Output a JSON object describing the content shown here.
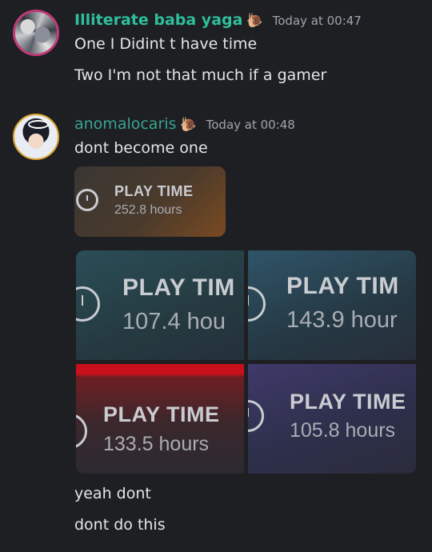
{
  "messages": [
    {
      "username": "Illiterate baba yaga",
      "badge_icon": "snail-icon",
      "timestamp": "Today at 00:47",
      "lines": [
        "One I Didint t have time",
        "Two I'm not that much if a gamer"
      ]
    },
    {
      "username": "anomalocaris",
      "badge_icon": "snail-icon",
      "timestamp": "Today at 00:48",
      "lines": [
        "dont become one",
        "yeah dont",
        "dont do this"
      ]
    }
  ],
  "attachments": {
    "small": {
      "title": "PLAY TIME",
      "hours": "252.8 hours"
    },
    "grid": [
      {
        "title": "PLAY TIM",
        "hours": "107.4 hou"
      },
      {
        "title": "PLAY TIM",
        "hours": "143.9 hour"
      },
      {
        "title": "PLAY TIME",
        "hours": "133.5 hours"
      },
      {
        "title": "PLAY TIME",
        "hours": "105.8 hours"
      }
    ]
  },
  "colors": {
    "background": "#1e1f23",
    "username1": "#2fbf9a",
    "username2": "#38a48f"
  }
}
